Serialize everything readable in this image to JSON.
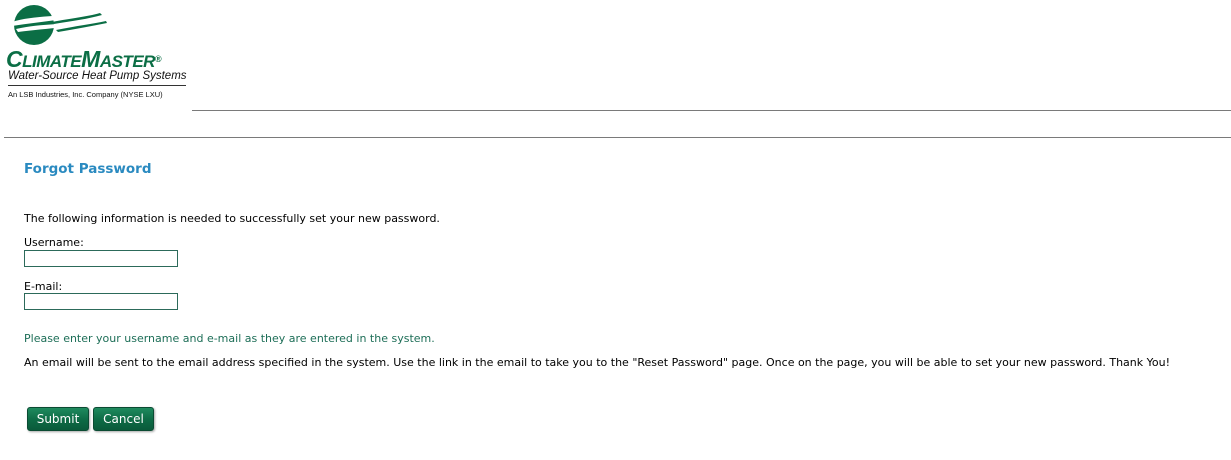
{
  "logo": {
    "brand_main": "ClimateMaster",
    "brand_first_cap": "C",
    "brand_first_rest": "LIMATE",
    "brand_second_cap": "M",
    "brand_second_rest": "ASTER",
    "registered_mark": "®",
    "tagline": "Water-Source Heat Pump Systems",
    "company": "An LSB Industries, Inc. Company (NYSE LXU)",
    "brand_color": "#0b6e45"
  },
  "form": {
    "title": "Forgot Password",
    "intro": "The following information is needed to successfully set your new password.",
    "username_label": "Username:",
    "username_value": "",
    "email_label": "E-mail:",
    "email_value": "",
    "hint": "Please enter your username and e-mail as they are entered in the system.",
    "info": "An email will be sent to the email address specified in the system. Use the link in the email to take you to the \"Reset Password\" page. Once on the page, you will be able to set your new password. Thank You!",
    "submit_label": "Submit",
    "cancel_label": "Cancel"
  },
  "colors": {
    "title": "#2a8ac0",
    "hint": "#1d6e57",
    "button": "#0d6a45"
  }
}
